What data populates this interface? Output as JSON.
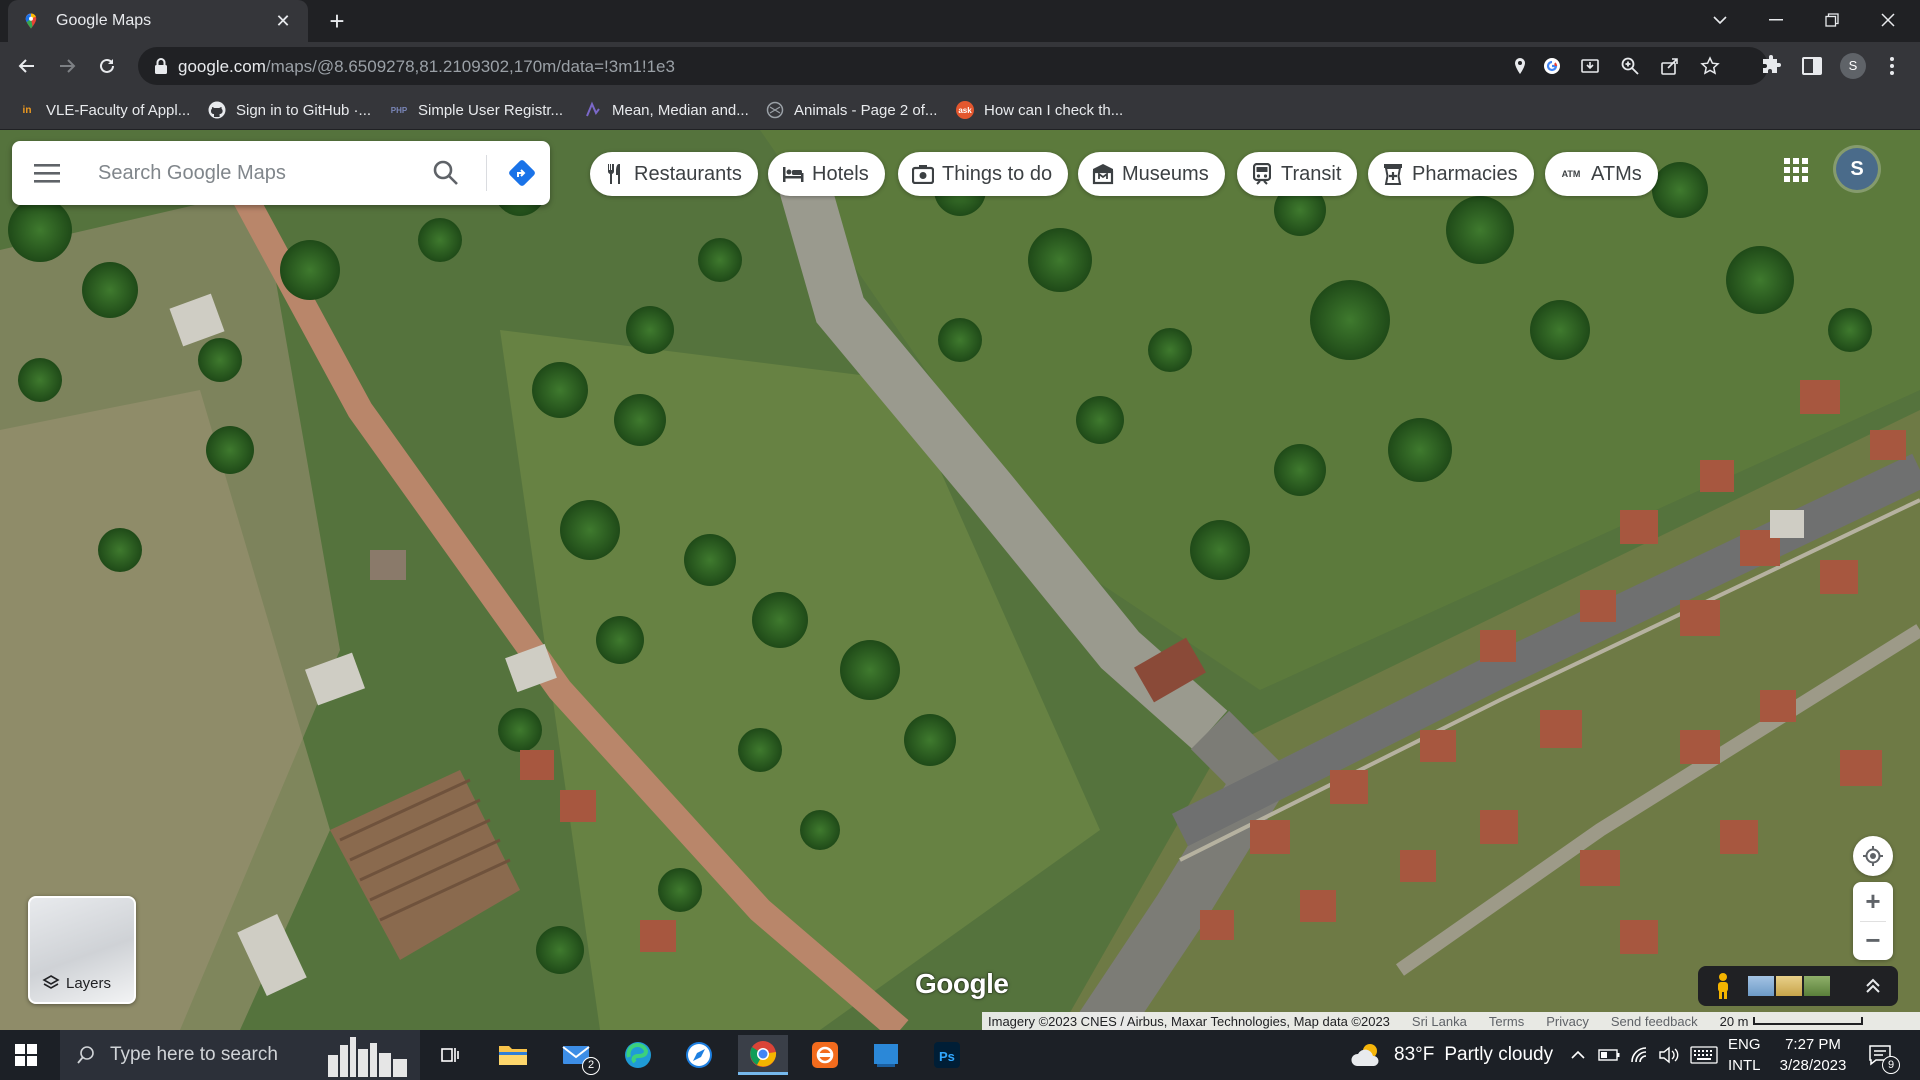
{
  "browser": {
    "tab_title": "Google Maps",
    "url_host": "google.com",
    "url_path": "/maps/@8.6509278,81.2109302,170m/data=!3m1!1e3",
    "profile_initial": "S",
    "bookmarks": [
      {
        "label": "VLE-Faculty of Appl...",
        "icon": "vle-icon"
      },
      {
        "label": "Sign in to GitHub ·...",
        "icon": "github-icon"
      },
      {
        "label": "Simple User Registr...",
        "icon": "php-icon"
      },
      {
        "label": "Mean, Median and...",
        "icon": "stats-icon"
      },
      {
        "label": "Animals - Page 2 of...",
        "icon": "animals-icon"
      },
      {
        "label": "How can I check th...",
        "icon": "ask-icon"
      }
    ]
  },
  "maps": {
    "search_placeholder": "Search Google Maps",
    "chips": [
      {
        "label": "Restaurants",
        "icon": "fork-knife-icon"
      },
      {
        "label": "Hotels",
        "icon": "bed-icon"
      },
      {
        "label": "Things to do",
        "icon": "camera-icon"
      },
      {
        "label": "Museums",
        "icon": "museum-icon"
      },
      {
        "label": "Transit",
        "icon": "train-icon"
      },
      {
        "label": "Pharmacies",
        "icon": "pharmacy-icon"
      },
      {
        "label": "ATMs",
        "icon": "atm-icon"
      }
    ],
    "account_initial": "S",
    "layers_label": "Layers",
    "logo": "Google",
    "attribution": "Imagery ©2023 CNES / Airbus, Maxar Technologies, Map data ©2023",
    "footer_links": [
      "Sri Lanka",
      "Terms",
      "Privacy",
      "Send feedback"
    ],
    "scale_label": "20 m",
    "zoom_in": "+",
    "zoom_out": "−"
  },
  "taskbar": {
    "search_placeholder": "Type here to search",
    "mail_badge": "2",
    "weather_temp": "83°F",
    "weather_desc": "Partly cloudy",
    "lang_line1": "ENG",
    "lang_line2": "INTL",
    "time": "7:27 PM",
    "date": "3/28/2023",
    "notifications": "9"
  }
}
